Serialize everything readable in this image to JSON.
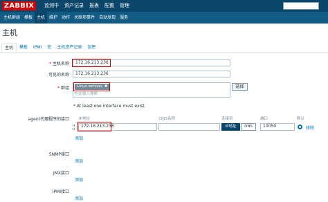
{
  "brand": {
    "logo_text": "ZABBIX",
    "color": "#d40000"
  },
  "top_nav": [
    "监测中",
    "资产记录",
    "报表",
    "配置",
    "管理"
  ],
  "sub_nav": [
    "主机群组",
    "模板",
    "主机",
    "维护",
    "动作",
    "关联项事件",
    "自动发现",
    "服务"
  ],
  "page_title": "主机",
  "tabs": [
    "主机",
    "模板",
    "IPMI",
    "宏",
    "主机资产记录",
    "加密"
  ],
  "form": {
    "host_name_label": "主机名称",
    "host_name_value": "172.16.213.236",
    "visible_name_label": "可见的名称",
    "visible_name_value": "172.16.213.236",
    "groups_label": "群组",
    "group_tag": "Linux servers",
    "group_tag_remove": "✖",
    "groups_placeholder": "在此输入搜索",
    "select_button": "选择",
    "warning": "* At least one interface must exist."
  },
  "interfaces": {
    "agent_label": "agent代理程序的接口",
    "col_ip": "IP地址",
    "col_dns": "DNS名称",
    "col_connect": "连接到",
    "col_port": "端口",
    "col_default": "默认",
    "ip_value": "172.16.213.236",
    "dns_value": "",
    "connect_ip": "IP地址",
    "connect_dns": "DNS",
    "port_value": "10050",
    "remove_link": "移除",
    "add_link": "添加",
    "snmp_label": "SNMP接口",
    "jmx_label": "JMX接口",
    "ipmi_label": "IPMI接口"
  }
}
